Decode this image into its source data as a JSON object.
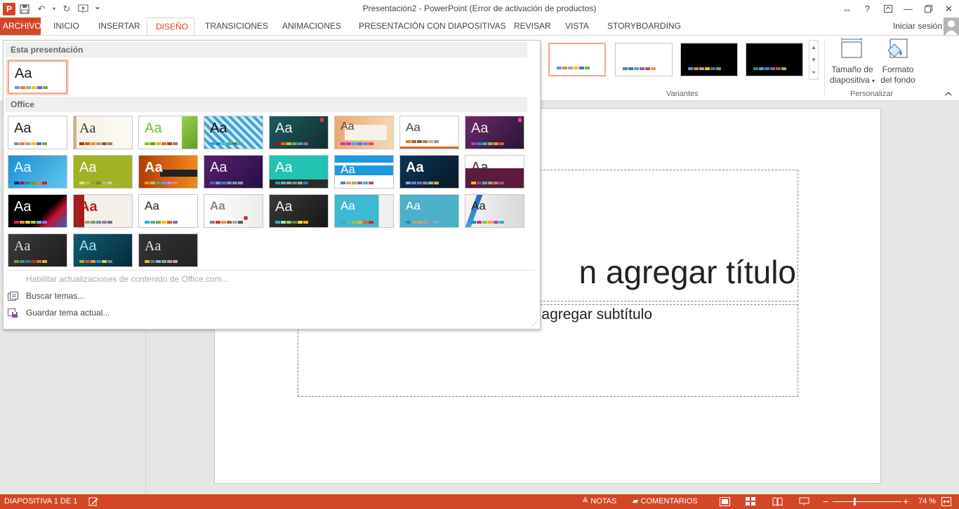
{
  "window": {
    "title": "Presentación2 - PowerPoint (Error de activación de productos)",
    "app_icon_letter": "P"
  },
  "tabs": [
    {
      "label": "ARCHIVO"
    },
    {
      "label": "INICIO"
    },
    {
      "label": "INSERTAR"
    },
    {
      "label": "DISEÑO"
    },
    {
      "label": "TRANSICIONES"
    },
    {
      "label": "ANIMACIONES"
    },
    {
      "label": "PRESENTACIÓN CON DIAPOSITIVAS"
    },
    {
      "label": "REVISAR"
    },
    {
      "label": "VISTA"
    },
    {
      "label": "STORYBOARDING"
    }
  ],
  "active_tab": "DISEÑO",
  "signin": "Iniciar sesión",
  "ribbon": {
    "variants_label": "Variantes",
    "customize_label": "Personalizar",
    "slide_size_line1": "Tamaño de",
    "slide_size_line2": "diapositiva",
    "format_bg_line1": "Formato",
    "format_bg_line2": "del fondo"
  },
  "slide": {
    "title_partial": "n agregar título",
    "subtitle_partial": "agregar subtítulo"
  },
  "gallery": {
    "this_presentation": "Esta presentación",
    "office": "Office",
    "theme_glyph": "Aa",
    "menu": {
      "enable_updates": "Habilitar actualizaciones de contenido de Office.com...",
      "browse_themes": "Buscar temas...",
      "save_theme": "Guardar tema actual..."
    }
  },
  "status": {
    "slide_indicator": "DIAPOSITIVA 1 DE 1",
    "notes": "NOTAS",
    "comments": "COMENTARIOS",
    "zoom": "74 %"
  },
  "colors": {
    "accent": "#d24726",
    "palette_office": [
      "#5b9bd5",
      "#ed7d31",
      "#a5a5a5",
      "#ffc000",
      "#4472c4",
      "#70ad47"
    ]
  }
}
